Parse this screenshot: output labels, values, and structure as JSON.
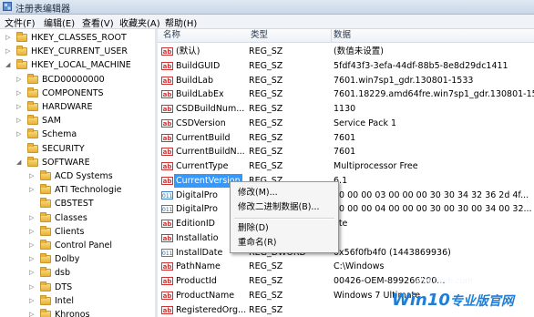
{
  "window": {
    "title": "注册表编辑器"
  },
  "menu": [
    "文件(F)",
    "编辑(E)",
    "查看(V)",
    "收藏夹(A)",
    "帮助(H)"
  ],
  "tree": [
    {
      "label": "HKEY_CLASSES_ROOT",
      "level": 0,
      "expand": "▷"
    },
    {
      "label": "HKEY_CURRENT_USER",
      "level": 0,
      "expand": "▷"
    },
    {
      "label": "HKEY_LOCAL_MACHINE",
      "level": 0,
      "expand": "◢"
    },
    {
      "label": "BCD00000000",
      "level": 1,
      "expand": "▷"
    },
    {
      "label": "COMPONENTS",
      "level": 1,
      "expand": "▷"
    },
    {
      "label": "HARDWARE",
      "level": 1,
      "expand": "▷"
    },
    {
      "label": "SAM",
      "level": 1,
      "expand": "▷"
    },
    {
      "label": "Schema",
      "level": 1,
      "expand": "▷"
    },
    {
      "label": "SECURITY",
      "level": 1,
      "expand": ""
    },
    {
      "label": "SOFTWARE",
      "level": 1,
      "expand": "◢"
    },
    {
      "label": "ACD Systems",
      "level": 2,
      "expand": "▷"
    },
    {
      "label": "ATI Technologie",
      "level": 2,
      "expand": "▷"
    },
    {
      "label": "CBSTEST",
      "level": 2,
      "expand": ""
    },
    {
      "label": "Classes",
      "level": 2,
      "expand": "▷"
    },
    {
      "label": "Clients",
      "level": 2,
      "expand": "▷"
    },
    {
      "label": "Control Panel",
      "level": 2,
      "expand": "▷"
    },
    {
      "label": "Dolby",
      "level": 2,
      "expand": "▷"
    },
    {
      "label": "dsb",
      "level": 2,
      "expand": "▷"
    },
    {
      "label": "DTS",
      "level": 2,
      "expand": "▷"
    },
    {
      "label": "Intel",
      "level": 2,
      "expand": "▷"
    },
    {
      "label": "Khronos",
      "level": 2,
      "expand": "▷"
    }
  ],
  "columns": {
    "name": "名称",
    "type": "类型",
    "data": "数据"
  },
  "values": [
    {
      "name": "(默认)",
      "type": "REG_SZ",
      "data": "(数值未设置)",
      "icon": "ab"
    },
    {
      "name": "BuildGUID",
      "type": "REG_SZ",
      "data": "5fdf43f3-3efa-44df-88b5-8e8d29dc1411",
      "icon": "ab"
    },
    {
      "name": "BuildLab",
      "type": "REG_SZ",
      "data": "7601.win7sp1_gdr.130801-1533",
      "icon": "ab"
    },
    {
      "name": "BuildLabEx",
      "type": "REG_SZ",
      "data": "7601.18229.amd64fre.win7sp1_gdr.130801-15...",
      "icon": "ab"
    },
    {
      "name": "CSDBuildNum...",
      "type": "REG_SZ",
      "data": "1130",
      "icon": "ab"
    },
    {
      "name": "CSDVersion",
      "type": "REG_SZ",
      "data": "Service Pack 1",
      "icon": "ab"
    },
    {
      "name": "CurrentBuild",
      "type": "REG_SZ",
      "data": "7601",
      "icon": "ab"
    },
    {
      "name": "CurrentBuildN...",
      "type": "REG_SZ",
      "data": "7601",
      "icon": "ab"
    },
    {
      "name": "CurrentType",
      "type": "REG_SZ",
      "data": "Multiprocessor Free",
      "icon": "ab"
    },
    {
      "name": "CurrentVersion",
      "type": "REG_SZ",
      "data": "6.1",
      "icon": "ab",
      "selected": true
    },
    {
      "name": "DigitalPro",
      "type": "",
      "data": "00 00 00 03 00 00 00 30 30 34 32 36 2d 4f...",
      "icon": "bin"
    },
    {
      "name": "DigitalPro",
      "type": "",
      "data": "00 00 00 04 00 00 00 30 00 30 00 34 00 32...",
      "icon": "bin"
    },
    {
      "name": "EditionID",
      "type": "",
      "data": "ate",
      "icon": "ab"
    },
    {
      "name": "Installatio",
      "type": "",
      "data": "",
      "icon": "ab"
    },
    {
      "name": "InstallDate",
      "type": "REG_DWORD",
      "data": "0x56f0fb4f0 (1443869936)",
      "icon": "bin"
    },
    {
      "name": "PathName",
      "type": "REG_SZ",
      "data": "C:\\Windows",
      "icon": "ab"
    },
    {
      "name": "ProductId",
      "type": "REG_SZ",
      "data": "00426-OEM-899266200...",
      "icon": "ab"
    },
    {
      "name": "ProductName",
      "type": "REG_SZ",
      "data": "Windows 7 Ultimate",
      "icon": "ab"
    },
    {
      "name": "RegisteredOrg...",
      "type": "REG_SZ",
      "data": "",
      "icon": "ab"
    }
  ],
  "context_menu": {
    "modify": "修改(M)...",
    "modify_binary": "修改二进制数据(B)...",
    "delete": "删除(D)",
    "rename": "重命名(R)"
  },
  "watermark": {
    "url": "win10zyb.com",
    "brand": "Win10",
    "brand_cn": "专业版官网"
  },
  "colors": {
    "selection": "#3399ff",
    "folder": "#e8b13c",
    "watermark": "#1f7fd6"
  }
}
